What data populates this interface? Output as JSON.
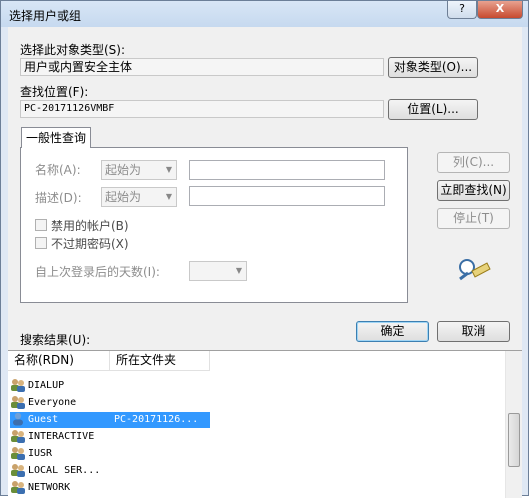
{
  "window": {
    "title": "选择用户或组",
    "help_glyph": "?",
    "close_glyph": "X"
  },
  "object_type": {
    "label": "选择此对象类型(S):",
    "value": "用户或内置安全主体",
    "button": "对象类型(O)..."
  },
  "location": {
    "label": "查找位置(F):",
    "value": "PC-20171126VMBF",
    "button": "位置(L)..."
  },
  "query": {
    "tab_label": "一般性查询",
    "name_label": "名称(A):",
    "desc_label": "描述(D):",
    "starts_with": "起始为",
    "disabled_accounts": "禁用的帐户(B)",
    "no_expire_password": "不过期密码(X)",
    "days_since_login": "自上次登录后的天数(I):"
  },
  "side_buttons": {
    "columns": "列(C)...",
    "find_now": "立即查找(N)",
    "stop": "停止(T)"
  },
  "ok": "确定",
  "cancel": "取消",
  "results": {
    "label": "搜索结果(U):",
    "columns": [
      "名称(RDN)",
      "所在文件夹"
    ],
    "rows": [
      {
        "name": "DIALUP",
        "folder": "",
        "icon": "group-icon"
      },
      {
        "name": "Everyone",
        "folder": "",
        "icon": "group-icon"
      },
      {
        "name": "Guest",
        "folder": "PC-20171126...",
        "icon": "user-icon",
        "selected": true
      },
      {
        "name": "INTERACTIVE",
        "folder": "",
        "icon": "group-icon"
      },
      {
        "name": "IUSR",
        "folder": "",
        "icon": "group-icon"
      },
      {
        "name": "LOCAL SER...",
        "folder": "",
        "icon": "group-icon"
      },
      {
        "name": "NETWORK",
        "folder": "",
        "icon": "group-icon"
      }
    ]
  }
}
